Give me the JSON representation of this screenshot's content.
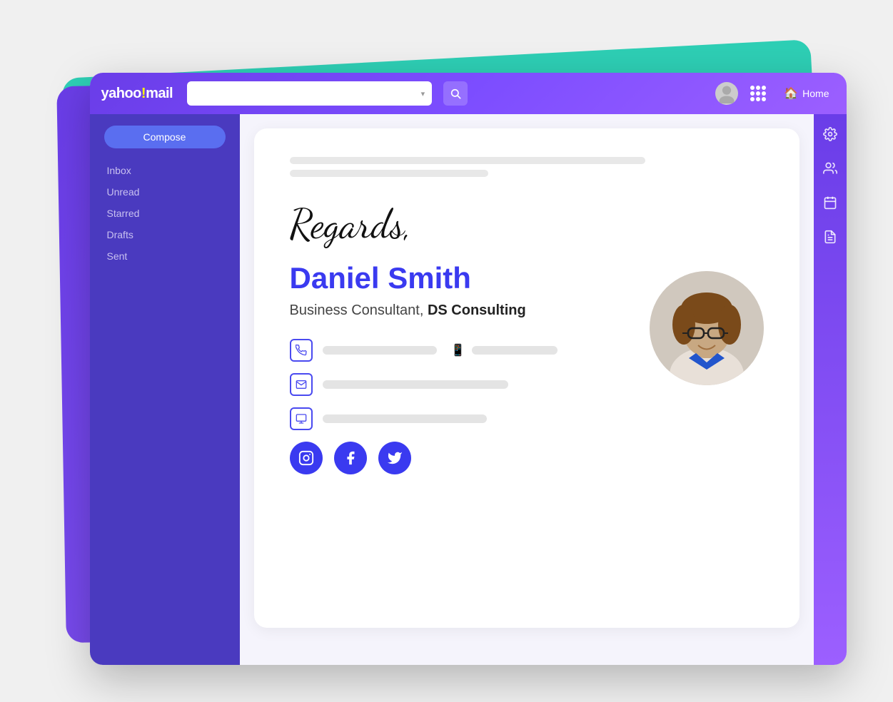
{
  "header": {
    "logo": "yahoo!mail",
    "logo_exclamation": "!",
    "search_placeholder": "",
    "home_label": "Home"
  },
  "sidebar": {
    "compose_label": "Compose",
    "nav_items": [
      {
        "id": "inbox",
        "label": "Inbox"
      },
      {
        "id": "unread",
        "label": "Unread"
      },
      {
        "id": "starred",
        "label": "Starred"
      },
      {
        "id": "drafts",
        "label": "Drafts"
      },
      {
        "id": "sent",
        "label": "Sent"
      }
    ]
  },
  "email": {
    "regards_text": "Regards,",
    "signature": {
      "name": "Daniel Smith",
      "title": "Business Consultant, ",
      "company": "DS Consulting"
    },
    "social": {
      "instagram_label": "Instagram",
      "facebook_label": "Facebook",
      "twitter_label": "Twitter"
    }
  },
  "colors": {
    "header_gradient_start": "#6a3de8",
    "header_gradient_end": "#9c5fff",
    "sidebar_bg": "#4a3abf",
    "compose_btn_bg": "#5a6ef0",
    "name_color": "#3a3af0",
    "social_color": "#3a3af0",
    "teal_deco": "#2ecfb5"
  }
}
